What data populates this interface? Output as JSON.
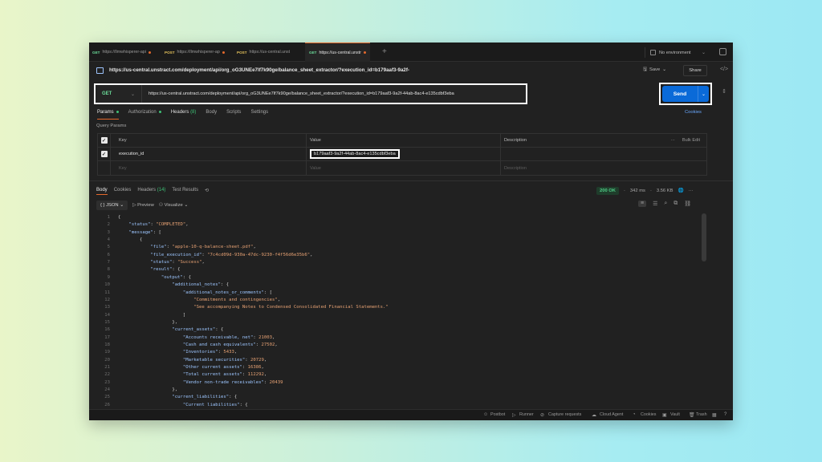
{
  "tabs": [
    {
      "method": "GET",
      "label": "https://llmwhisperer-api",
      "active": false
    },
    {
      "method": "POST",
      "label": "https://llmwhisperer-ap",
      "active": false
    },
    {
      "method": "POST",
      "label": "https://us-central.unst",
      "active": false
    },
    {
      "method": "GET",
      "label": "https://us-central.unstr",
      "active": true
    }
  ],
  "environment": "No environment",
  "request_title": "https://us-central.unstract.com/deployment/api/org_oG3UNEe7lf7k90ge/balance_sheet_extractor/?execution_id=b179aaf3-9a2f-",
  "save_label": "Save",
  "share_label": "Share",
  "method": "GET",
  "url": "https://us-central.unstract.com/deployment/api/org_oG3UNEe7lf7k90ge/balance_sheet_extractor/?execution_id=b179aaf3-9a2f-44ab-8ac4-e135cdbf3eba",
  "send_label": "Send",
  "request_tabs": {
    "params": "Params",
    "authorization": "Authorization",
    "headers": "Headers",
    "headers_count": "(8)",
    "body": "Body",
    "scripts": "Scripts",
    "settings": "Settings",
    "cookies": "Cookies"
  },
  "query_params": {
    "title": "Query Params",
    "headers": {
      "key": "Key",
      "value": "Value",
      "description": "Description",
      "bulk_edit": "Bulk Edit"
    },
    "row": {
      "key": "execution_id",
      "value": "b179aaf3-9a2f-44ab-8ac4-e135cdbf3eba"
    },
    "placeholder": {
      "key": "Key",
      "value": "Value",
      "description": "Description"
    }
  },
  "response_tabs": {
    "body": "Body",
    "cookies": "Cookies",
    "headers": "Headers",
    "headers_count": "(14)",
    "tests": "Test Results"
  },
  "response_status": {
    "code": "200 OK",
    "time": "342 ms",
    "size": "3.56 KB"
  },
  "format": {
    "json": "JSON",
    "preview": "Preview",
    "visualize": "Visualize"
  },
  "code_lines": [
    [
      {
        "t": "p",
        "v": "{"
      }
    ],
    [
      {
        "t": "p",
        "v": "    "
      },
      {
        "t": "k",
        "v": "\"status\""
      },
      {
        "t": "p",
        "v": ": "
      },
      {
        "t": "s",
        "v": "\"COMPLETED\""
      },
      {
        "t": "p",
        "v": ","
      }
    ],
    [
      {
        "t": "p",
        "v": "    "
      },
      {
        "t": "k",
        "v": "\"message\""
      },
      {
        "t": "p",
        "v": ": ["
      }
    ],
    [
      {
        "t": "p",
        "v": "        {"
      }
    ],
    [
      {
        "t": "p",
        "v": "            "
      },
      {
        "t": "k",
        "v": "\"file\""
      },
      {
        "t": "p",
        "v": ": "
      },
      {
        "t": "s",
        "v": "\"apple-10-q-balance-sheet.pdf\""
      },
      {
        "t": "p",
        "v": ","
      }
    ],
    [
      {
        "t": "p",
        "v": "            "
      },
      {
        "t": "k",
        "v": "\"file_execution_id\""
      },
      {
        "t": "p",
        "v": ": "
      },
      {
        "t": "s",
        "v": "\"7c4cd09d-930a-47dc-9230-f4f56d6e35b6\""
      },
      {
        "t": "p",
        "v": ","
      }
    ],
    [
      {
        "t": "p",
        "v": "            "
      },
      {
        "t": "k",
        "v": "\"status\""
      },
      {
        "t": "p",
        "v": ": "
      },
      {
        "t": "s",
        "v": "\"Success\""
      },
      {
        "t": "p",
        "v": ","
      }
    ],
    [
      {
        "t": "p",
        "v": "            "
      },
      {
        "t": "k",
        "v": "\"result\""
      },
      {
        "t": "p",
        "v": ": {"
      }
    ],
    [
      {
        "t": "p",
        "v": "                "
      },
      {
        "t": "k",
        "v": "\"output\""
      },
      {
        "t": "p",
        "v": ": {"
      }
    ],
    [
      {
        "t": "p",
        "v": "                    "
      },
      {
        "t": "k",
        "v": "\"additional_notes\""
      },
      {
        "t": "p",
        "v": ": {"
      }
    ],
    [
      {
        "t": "p",
        "v": "                        "
      },
      {
        "t": "k",
        "v": "\"additional_notes_or_comments\""
      },
      {
        "t": "p",
        "v": ": ["
      }
    ],
    [
      {
        "t": "p",
        "v": "                            "
      },
      {
        "t": "s",
        "v": "\"Commitments and contingencies\""
      },
      {
        "t": "p",
        "v": ","
      }
    ],
    [
      {
        "t": "p",
        "v": "                            "
      },
      {
        "t": "s",
        "v": "\"See accompanying Notes to Condensed Consolidated Financial Statements.\""
      }
    ],
    [
      {
        "t": "p",
        "v": "                        ]"
      }
    ],
    [
      {
        "t": "p",
        "v": "                    },"
      }
    ],
    [
      {
        "t": "p",
        "v": "                    "
      },
      {
        "t": "k",
        "v": "\"current_assets\""
      },
      {
        "t": "p",
        "v": ": {"
      }
    ],
    [
      {
        "t": "p",
        "v": "                        "
      },
      {
        "t": "k",
        "v": "\"Accounts receivable, net\""
      },
      {
        "t": "p",
        "v": ": "
      },
      {
        "t": "n",
        "v": "21003"
      },
      {
        "t": "p",
        "v": ","
      }
    ],
    [
      {
        "t": "p",
        "v": "                        "
      },
      {
        "t": "k",
        "v": "\"Cash and cash equivalents\""
      },
      {
        "t": "p",
        "v": ": "
      },
      {
        "t": "n",
        "v": "27502"
      },
      {
        "t": "p",
        "v": ","
      }
    ],
    [
      {
        "t": "p",
        "v": "                        "
      },
      {
        "t": "k",
        "v": "\"Inventories\""
      },
      {
        "t": "p",
        "v": ": "
      },
      {
        "t": "n",
        "v": "5433"
      },
      {
        "t": "p",
        "v": ","
      }
    ],
    [
      {
        "t": "p",
        "v": "                        "
      },
      {
        "t": "k",
        "v": "\"Marketable securities\""
      },
      {
        "t": "p",
        "v": ": "
      },
      {
        "t": "n",
        "v": "20729"
      },
      {
        "t": "p",
        "v": ","
      }
    ],
    [
      {
        "t": "p",
        "v": "                        "
      },
      {
        "t": "k",
        "v": "\"Other current assets\""
      },
      {
        "t": "p",
        "v": ": "
      },
      {
        "t": "n",
        "v": "16386"
      },
      {
        "t": "p",
        "v": ","
      }
    ],
    [
      {
        "t": "p",
        "v": "                        "
      },
      {
        "t": "k",
        "v": "\"Total current assets\""
      },
      {
        "t": "p",
        "v": ": "
      },
      {
        "t": "n",
        "v": "112292"
      },
      {
        "t": "p",
        "v": ","
      }
    ],
    [
      {
        "t": "p",
        "v": "                        "
      },
      {
        "t": "k",
        "v": "\"Vendor non-trade receivables\""
      },
      {
        "t": "p",
        "v": ": "
      },
      {
        "t": "n",
        "v": "20439"
      }
    ],
    [
      {
        "t": "p",
        "v": "                    },"
      }
    ],
    [
      {
        "t": "p",
        "v": "                    "
      },
      {
        "t": "k",
        "v": "\"current_liabilities\""
      },
      {
        "t": "p",
        "v": ": {"
      }
    ],
    [
      {
        "t": "p",
        "v": "                        "
      },
      {
        "t": "k",
        "v": "\"Current liabilities\""
      },
      {
        "t": "p",
        "v": ": {"
      }
    ]
  ],
  "statusbar": {
    "postbot": "Postbot",
    "runner": "Runner",
    "capture": "Capture requests",
    "agent": "Cloud Agent",
    "cookies": "Cookies",
    "vault": "Vault",
    "trash": "Trash"
  },
  "colors": {
    "accent": "#e4692c",
    "send": "#0a6ad8",
    "get": "#6bdd9a",
    "ok": "#4fd088"
  }
}
